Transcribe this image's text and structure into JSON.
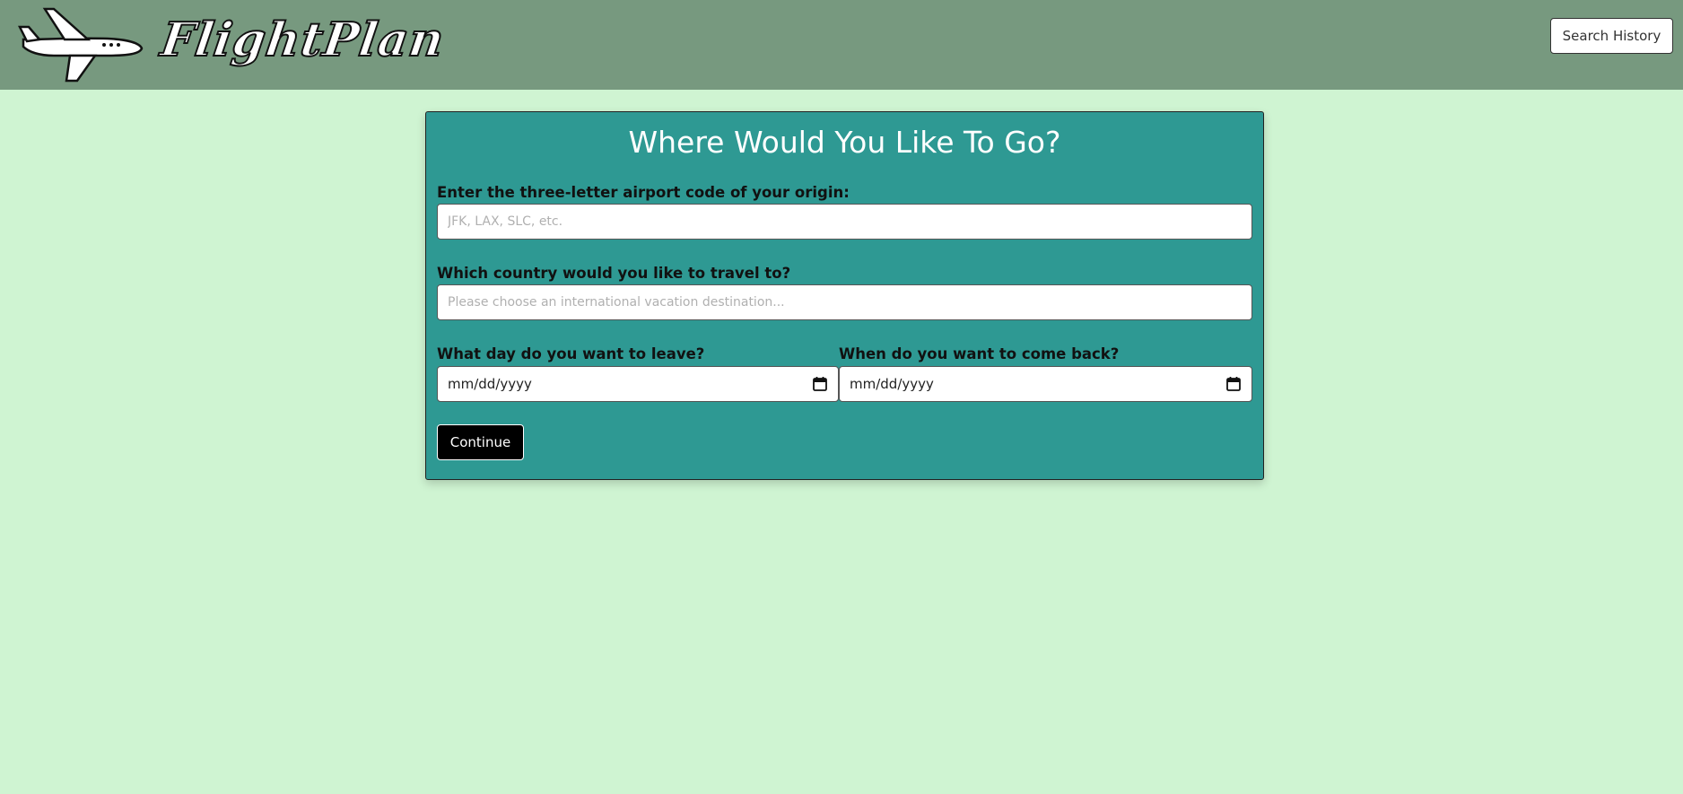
{
  "header": {
    "logo_text": "FlightPlan",
    "search_history_label": "Search History"
  },
  "form": {
    "title": "Where Would You Like To Go?",
    "origin": {
      "label": "Enter the three-letter airport code of your origin:",
      "placeholder": "JFK, LAX, SLC, etc.",
      "value": ""
    },
    "destination": {
      "label": "Which country would you like to travel to?",
      "placeholder": "Please choose an international vacation destination...",
      "value": ""
    },
    "depart": {
      "label": "What day do you want to leave?",
      "placeholder": "mm/dd/yyyy"
    },
    "return": {
      "label": "When do you want to come back?",
      "placeholder": "mm/dd/yyyy"
    },
    "continue_label": "Continue"
  },
  "colors": {
    "page_background": "#cff4d2",
    "navbar": "#77997f",
    "card": "#2e9993",
    "button_dark": "#000000"
  },
  "icons": {
    "logo": "airplane-icon",
    "date_picker": "calendar-icon"
  }
}
